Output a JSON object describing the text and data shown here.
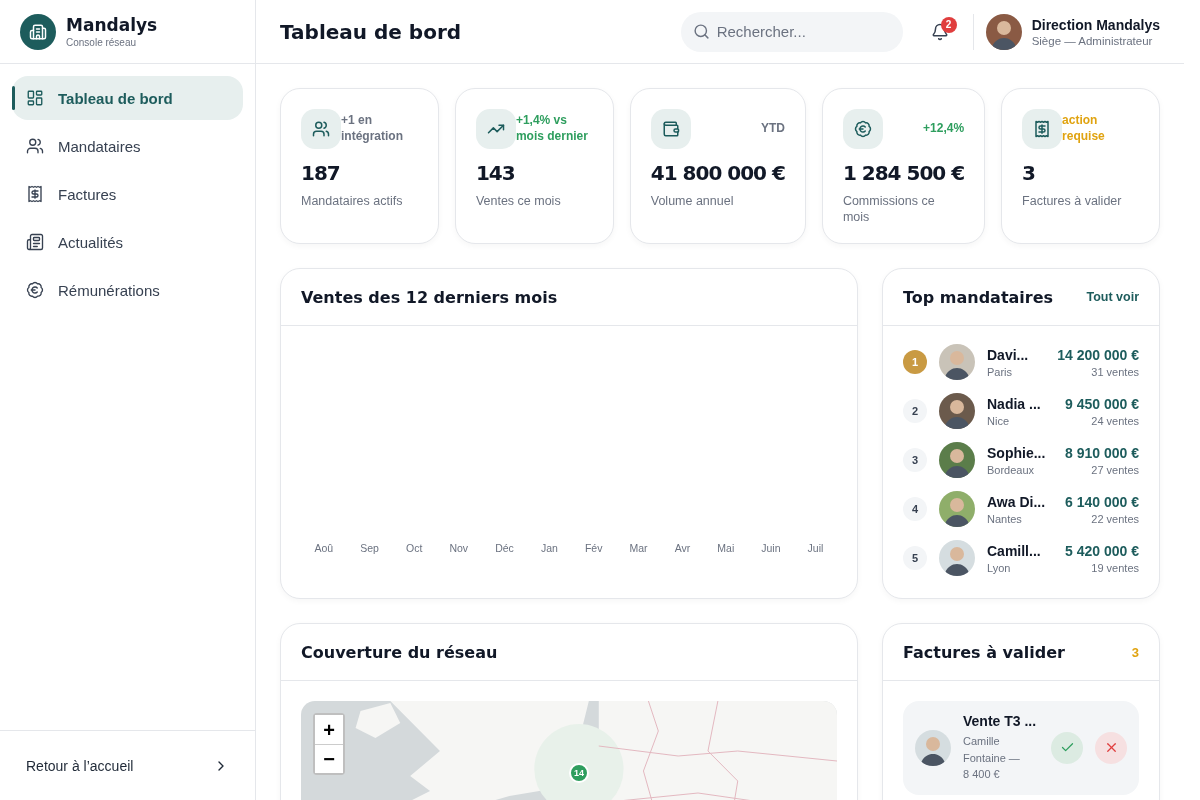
{
  "brand": {
    "name": "Mandalys",
    "subtitle": "Console réseau"
  },
  "sidebar": {
    "items": [
      {
        "label": "Tableau de bord",
        "selected": true
      },
      {
        "label": "Mandataires",
        "selected": false
      },
      {
        "label": "Factures",
        "selected": false
      },
      {
        "label": "Actualités",
        "selected": false
      },
      {
        "label": "Rémunérations",
        "selected": false
      }
    ],
    "footer_link": "Retour à l’accueil"
  },
  "header": {
    "title": "Tableau de bord",
    "search": {
      "placeholder": "Rechercher..."
    },
    "notifications": "2",
    "user": {
      "name": "Direction Mandalys",
      "role": "Siège — Administrateur"
    }
  },
  "stats": [
    {
      "trend": "+1 en intégration",
      "color": "#6b7280",
      "value": "187",
      "label": "Mandataires actifs"
    },
    {
      "trend": "+1,4% vs mois dernier",
      "color": "#2e9e5e",
      "value": "143",
      "label": "Ventes ce mois"
    },
    {
      "trend": "YTD",
      "color": "#6b7280",
      "value": "41 800 000 €",
      "label": "Volume annuel"
    },
    {
      "trend": "+12,4%",
      "color": "#2e9e5e",
      "value": "1 284 500 €",
      "label": "Commissions ce mois"
    },
    {
      "trend": "action requise",
      "color": "#e0a310",
      "value": "3",
      "label": "Factures à valider"
    }
  ],
  "sales_chart": {
    "title": "Ventes des 12 derniers mois",
    "months": [
      "Aoû",
      "Sep",
      "Oct",
      "Nov",
      "Déc",
      "Jan",
      "Fév",
      "Mar",
      "Avr",
      "Mai",
      "Juin",
      "Juil"
    ]
  },
  "top_agents": {
    "title": "Top mandataires",
    "link": "Tout voir",
    "items": [
      {
        "rank": "1",
        "medal": true,
        "name": "Davi...",
        "city": "Paris",
        "amount": "14 200 000 €",
        "sales": "31 ventes"
      },
      {
        "rank": "2",
        "medal": false,
        "name": "Nadia ...",
        "city": "Nice",
        "amount": "9 450 000 €",
        "sales": "24 ventes"
      },
      {
        "rank": "3",
        "medal": false,
        "name": "Sophie...",
        "city": "Bordeaux",
        "amount": "8 910 000 €",
        "sales": "27 ventes"
      },
      {
        "rank": "4",
        "medal": false,
        "name": "Awa Di...",
        "city": "Nantes",
        "amount": "6 140 000 €",
        "sales": "22 ventes"
      },
      {
        "rank": "5",
        "medal": false,
        "name": "Camill...",
        "city": "Lyon",
        "amount": "5 420 000 €",
        "sales": "19 ventes"
      }
    ]
  },
  "coverage": {
    "title": "Couverture du réseau",
    "map": {
      "zoom_in": "+",
      "zoom_out": "−",
      "cluster": "14"
    }
  },
  "invoices": {
    "title": "Factures à valider",
    "count": "3",
    "items": [
      {
        "title": "Vente T3 ...",
        "detail": "Camille Fontaine — 8 400 €"
      }
    ]
  }
}
